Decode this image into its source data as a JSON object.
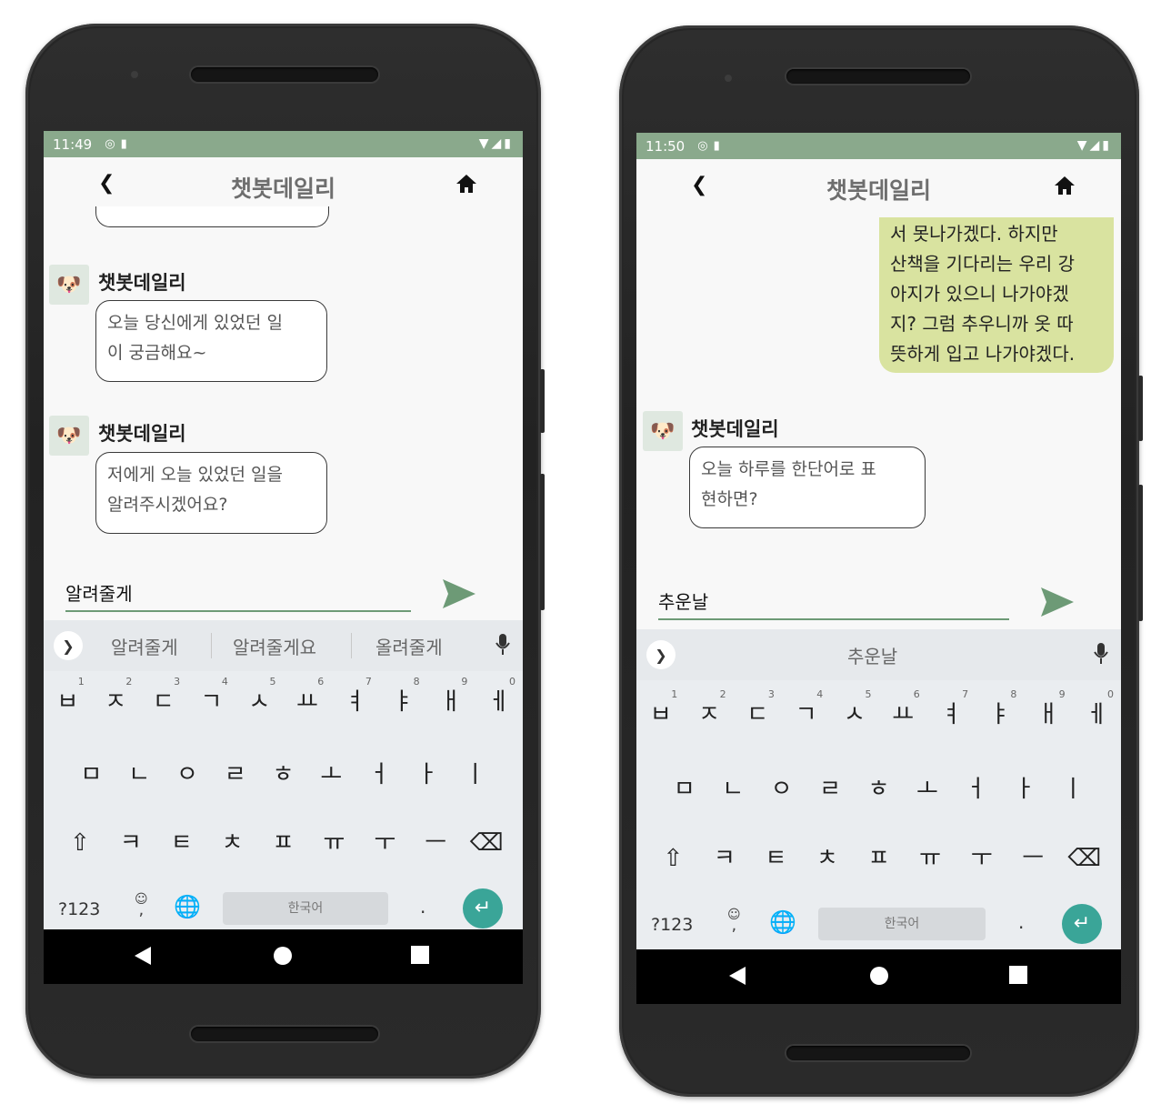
{
  "phones": [
    {
      "status_time": "11:49",
      "app_title": "챗봇데일리",
      "messages": [
        {
          "sender": "챗봇데일리",
          "lines": [
            "오늘 당신에게 있었던 일",
            "이 궁금해요~"
          ]
        },
        {
          "sender": "챗봇데일리",
          "lines": [
            "저에게 오늘 있었던 일을",
            "알려주시겠어요?"
          ]
        }
      ],
      "input_value": "알려줄게",
      "suggestions": [
        "알려줄게",
        "알려줄게요",
        "올려줄게"
      ]
    },
    {
      "status_time": "11:50",
      "app_title": "챗봇데일리",
      "user_message_lines": [
        "서 못나가겠다. 하지만",
        "산책을 기다리는 우리 강",
        "아지가 있으니 나가야겠",
        "지? 그럼 추우니까 옷 따",
        "뜻하게 입고 나가야겠다."
      ],
      "messages": [
        {
          "sender": "챗봇데일리",
          "lines": [
            "오늘 하루를 한단어로 표",
            "현하면?"
          ]
        }
      ],
      "input_value": "추운날",
      "suggestions": [
        "추운날"
      ]
    }
  ],
  "keyboard": {
    "row1": [
      {
        "k": "ㅂ",
        "n": "1"
      },
      {
        "k": "ㅈ",
        "n": "2"
      },
      {
        "k": "ㄷ",
        "n": "3"
      },
      {
        "k": "ㄱ",
        "n": "4"
      },
      {
        "k": "ㅅ",
        "n": "5"
      },
      {
        "k": "ㅛ",
        "n": "6"
      },
      {
        "k": "ㅕ",
        "n": "7"
      },
      {
        "k": "ㅑ",
        "n": "8"
      },
      {
        "k": "ㅐ",
        "n": "9"
      },
      {
        "k": "ㅔ",
        "n": "0"
      }
    ],
    "row2": [
      "ㅁ",
      "ㄴ",
      "ㅇ",
      "ㄹ",
      "ㅎ",
      "ㅗ",
      "ㅓ",
      "ㅏ",
      "ㅣ"
    ],
    "row3": [
      "⇧",
      "ㅋ",
      "ㅌ",
      "ㅊ",
      "ㅍ",
      "ㅠ",
      "ㅜ",
      "ㅡ",
      "⌫"
    ],
    "symbols_key": "?123",
    "emoji_key": "☺",
    "comma_key": ",",
    "space_label": "한국어",
    "period_key": ".",
    "enter_glyph": "↵"
  },
  "icons": {
    "back": "chevron-left",
    "home": "home",
    "send": "send",
    "mic": "microphone",
    "globe": "globe",
    "expand": "chevron-right",
    "status": "wifi-signal-battery"
  },
  "colors": {
    "status_bar": "#8aa98c",
    "user_bubble": "#d9e3a0",
    "send_icon": "#6d9a76",
    "enter_key": "#3aa598"
  }
}
